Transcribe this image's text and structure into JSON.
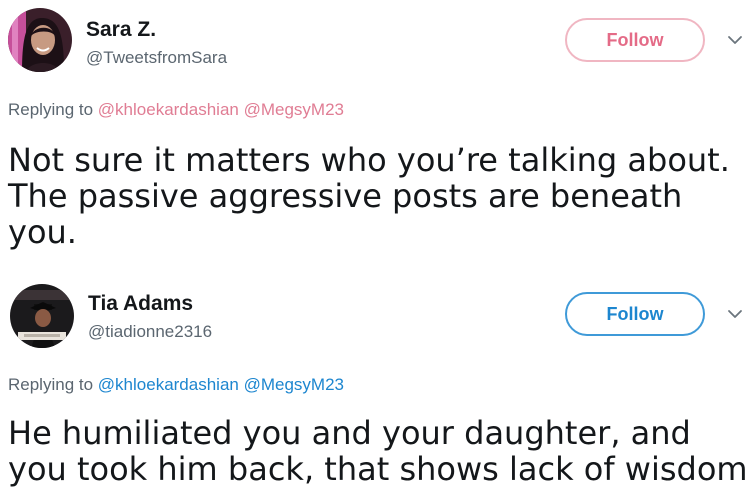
{
  "tweets": [
    {
      "name": "Sara Z.",
      "handle": "@TweetsfromSara",
      "follow_label": "Follow",
      "replying_prefix": "Replying to",
      "mentions": [
        "@khloekardashian",
        "@MegsyM23"
      ],
      "body": "Not sure it matters who you’re talking about. The passive aggressive posts are beneath you.",
      "follow_color": "#e46b87",
      "avatar_icon": "profile-photo-woman"
    },
    {
      "name": "Tia Adams",
      "handle": "@tiadionne2316",
      "follow_label": "Follow",
      "replying_prefix": "Replying to",
      "mentions": [
        "@khloekardashian",
        "@MegsyM23"
      ],
      "body": "He humiliated you and your daughter, and you took him back, that shows lack of wisdom",
      "follow_color": "#1d86cf",
      "avatar_icon": "profile-photo-graduation"
    }
  ]
}
